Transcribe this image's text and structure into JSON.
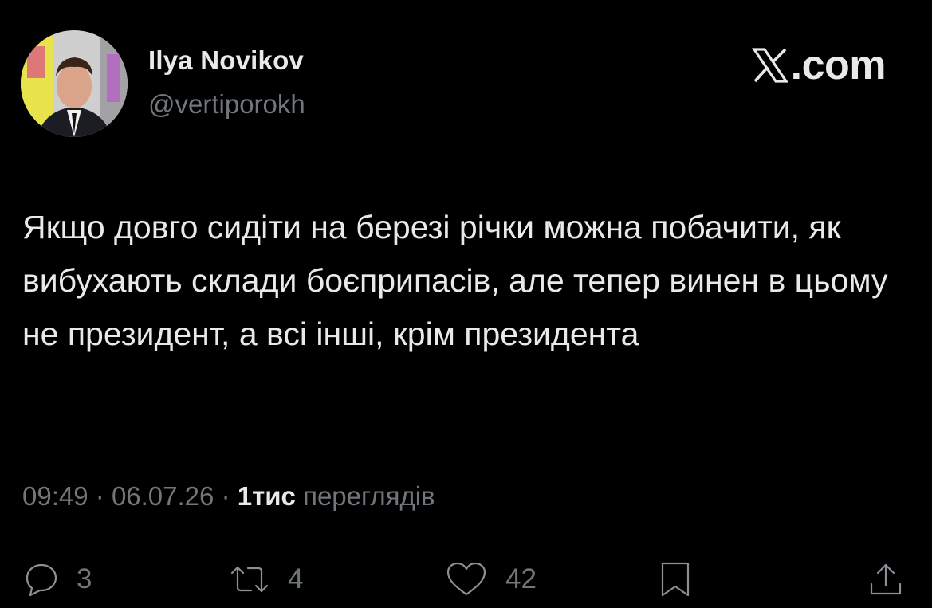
{
  "author": {
    "name": "Ilya Novikov",
    "handle": "@vertiporokh"
  },
  "brand": {
    "label": ".com",
    "logo_icon": "x-logo-icon"
  },
  "tweet": {
    "text": "Якщо довго сидіти на березі річки можна побачити, як вибухають склади боєприпасів, але тепер винен в цьому не президент, а всі інші, крім президента"
  },
  "meta": {
    "time": "09:49",
    "separator": "·",
    "date": "06.07.26",
    "views_count": "1тис",
    "views_label": "переглядів"
  },
  "actions": {
    "replies": "3",
    "reposts": "4",
    "likes": "42"
  },
  "colors": {
    "background": "#000000",
    "primary_text": "#e7e9ea",
    "secondary_text": "#71767b"
  }
}
